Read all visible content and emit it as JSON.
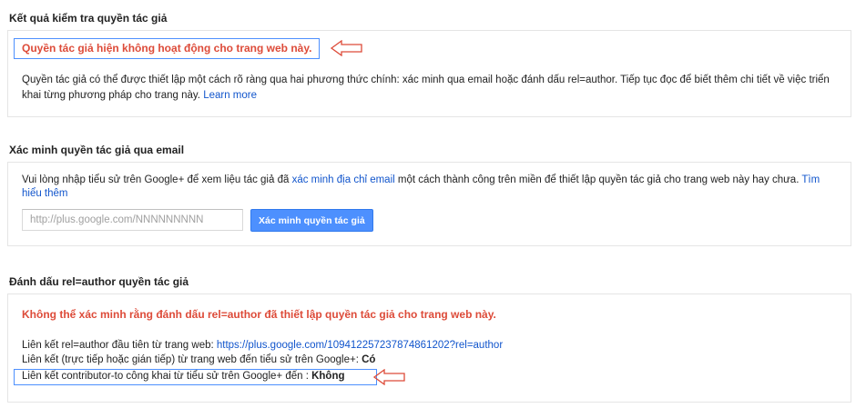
{
  "section1": {
    "title": "Kết quả kiểm tra quyền tác giả",
    "status": "Quyền tác giả hiện không hoạt động cho trang web này.",
    "description": "Quyền tác giả có thể được thiết lập một cách rõ ràng qua hai phương thức chính: xác minh qua email hoặc đánh dấu rel=author. Tiếp tục đọc để biết thêm chi tiết về việc triển khai từng phương pháp cho trang này.",
    "learn_more": "Learn more"
  },
  "section2": {
    "title": "Xác minh quyền tác giả qua email",
    "desc_before": "Vui lòng nhập tiểu sử trên Google+ để xem liệu tác giả đã ",
    "desc_link": "xác minh địa chỉ email",
    "desc_after": " một cách thành công trên miền  để thiết lập quyền tác giả cho trang web này hay chưa. ",
    "more_link": "Tìm hiểu thêm",
    "input_placeholder": "http://plus.google.com/NNNNNNNNN",
    "button_label": "Xác minh quyền tác giả"
  },
  "section3": {
    "title": "Đánh dấu rel=author quyền tác giả",
    "status": "Không thể xác minh rằng đánh dấu rel=author đã thiết lập quyền tác giả cho trang web này.",
    "line1_label": "Liên kết rel=author đầu tiên từ trang web: ",
    "line1_link": "https://plus.google.com/109412257237874861202?rel=author",
    "line2_label": "Liên kết (trực tiếp hoặc gián tiếp) từ trang web đến tiểu sử trên Google+: ",
    "line2_value": "Có",
    "line3_label": "Liên kết contributor-to công khai từ tiểu sử trên Google+ đến : ",
    "line3_value": "Không"
  },
  "colors": {
    "error_red": "#dd4b39",
    "link_blue": "#1155cc",
    "button_blue": "#4d90fe",
    "highlight_border": "#4d90fe",
    "arrow_red": "#dd4b39"
  },
  "icons": [
    "left-arrow-icon"
  ]
}
